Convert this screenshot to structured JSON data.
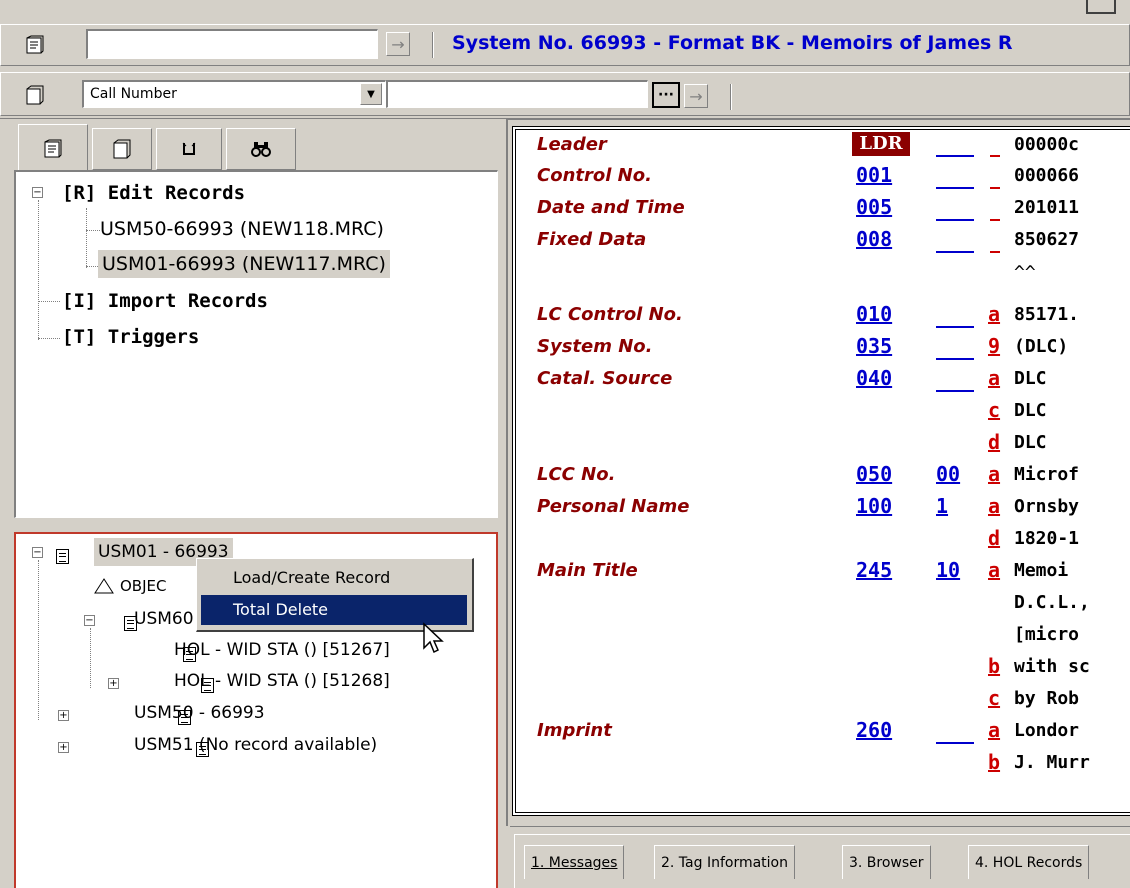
{
  "toolbar": {
    "record_input_value": "",
    "title": "System No. 66993 - Format BK - Memoirs of James R",
    "search_type": "Call Number",
    "search_value": ""
  },
  "nav_tabs": [
    "edit-records-tab",
    "records-tab",
    "triggers-tab",
    "find-tab"
  ],
  "tree": {
    "edit_records": "[R] Edit Records",
    "file1": "USM50-66993 (NEW118.MRC)",
    "file2": "USM01-66993 (NEW117.MRC)",
    "import_records": "[I] Import Records",
    "triggers": "[T] Triggers"
  },
  "lower_tree": {
    "root": "USM01 - 66993",
    "objects": "OBJEC",
    "usm60": "USM60",
    "hol1": "HOL - WID STA () [51267]",
    "hol2": "HOL - WID STA () [51268]",
    "usm50": "USM50 - 66993",
    "usm51": "USM51 (No record available)"
  },
  "context_menu": {
    "items": [
      "Load/Create Record",
      "Total Delete"
    ],
    "selected": "Total Delete"
  },
  "marc": {
    "rows": [
      {
        "label": "Leader",
        "tag": "LDR",
        "ind": "",
        "sub": "",
        "value": "00000c"
      },
      {
        "label": "Control No.",
        "tag": "001",
        "ind": "",
        "sub": "",
        "value": "000066"
      },
      {
        "label": "Date and Time",
        "tag": "005",
        "ind": "",
        "sub": "",
        "value": "201011"
      },
      {
        "label": "Fixed Data",
        "tag": "008",
        "ind": "",
        "sub": "",
        "value": "850627"
      },
      {
        "label": "",
        "tag": "",
        "ind": "",
        "sub": "",
        "value": "^^"
      },
      {
        "label": "LC Control No.",
        "tag": "010",
        "ind": "",
        "sub": "a",
        "value": "85171."
      },
      {
        "label": "System No.",
        "tag": "035",
        "ind": "",
        "sub": "9",
        "value": "(DLC)"
      },
      {
        "label": "Catal. Source",
        "tag": "040",
        "ind": "",
        "sub": "a",
        "value": "DLC"
      },
      {
        "label": "",
        "tag": "",
        "ind": "",
        "sub": "c",
        "value": "DLC"
      },
      {
        "label": "",
        "tag": "",
        "ind": "",
        "sub": "d",
        "value": "DLC"
      },
      {
        "label": "LCC No.",
        "tag": "050",
        "ind": "00",
        "sub": "a",
        "value": "Microf"
      },
      {
        "label": "Personal Name",
        "tag": "100",
        "ind": "1",
        "sub": "a",
        "value": "Ornsby"
      },
      {
        "label": "",
        "tag": "",
        "ind": "",
        "sub": "d",
        "value": "1820-1"
      },
      {
        "label": "Main Title",
        "tag": "245",
        "ind": "10",
        "sub": "a",
        "value": "Memoi"
      },
      {
        "label": "",
        "tag": "",
        "ind": "",
        "sub": "",
        "value": "D.C.L.,"
      },
      {
        "label": "",
        "tag": "",
        "ind": "",
        "sub": "",
        "value": "[micro"
      },
      {
        "label": "",
        "tag": "",
        "ind": "",
        "sub": "b",
        "value": "with sc"
      },
      {
        "label": "",
        "tag": "",
        "ind": "",
        "sub": "c",
        "value": "by Rob"
      },
      {
        "label": "Imprint",
        "tag": "260",
        "ind": "",
        "sub": "a",
        "value": "Londor"
      },
      {
        "label": "",
        "tag": "",
        "ind": "",
        "sub": "b",
        "value": "J. Murr"
      }
    ]
  },
  "bottom_tabs": [
    "1. Messages",
    "2. Tag Information",
    "3. Browser",
    "4. HOL Records"
  ],
  "colors": {
    "title_blue": "#0000cc",
    "label_red": "#8b0000",
    "selection_navy": "#0a246a",
    "panel_border_red": "#c0392b"
  }
}
